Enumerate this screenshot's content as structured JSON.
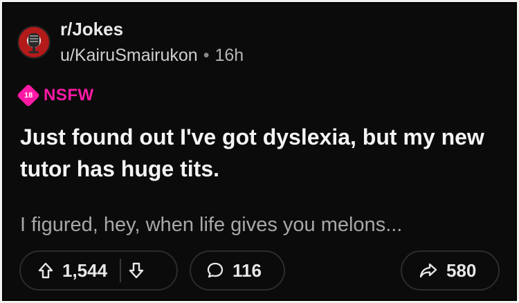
{
  "post": {
    "subreddit": "r/Jokes",
    "author": "u/KairuSmairukon",
    "separator": "•",
    "age": "16h",
    "nsfw_badge": "18",
    "nsfw_label": "NSFW",
    "title": "Just found out I've got dyslexia, but my new tutor has huge tits.",
    "body": "I figured, hey, when life gives you melons..."
  },
  "actions": {
    "upvotes": "1,544",
    "comments": "116",
    "shares": "580"
  },
  "icons": {
    "avatar": "subreddit-avatar",
    "upvote": "arrow-up-icon",
    "downvote": "arrow-down-icon",
    "comment": "speech-bubble-icon",
    "share": "share-arrow-icon"
  },
  "colors": {
    "nsfw": "#ff1aa6",
    "background": "#0b0b0b",
    "text": "#f4f4f4"
  }
}
